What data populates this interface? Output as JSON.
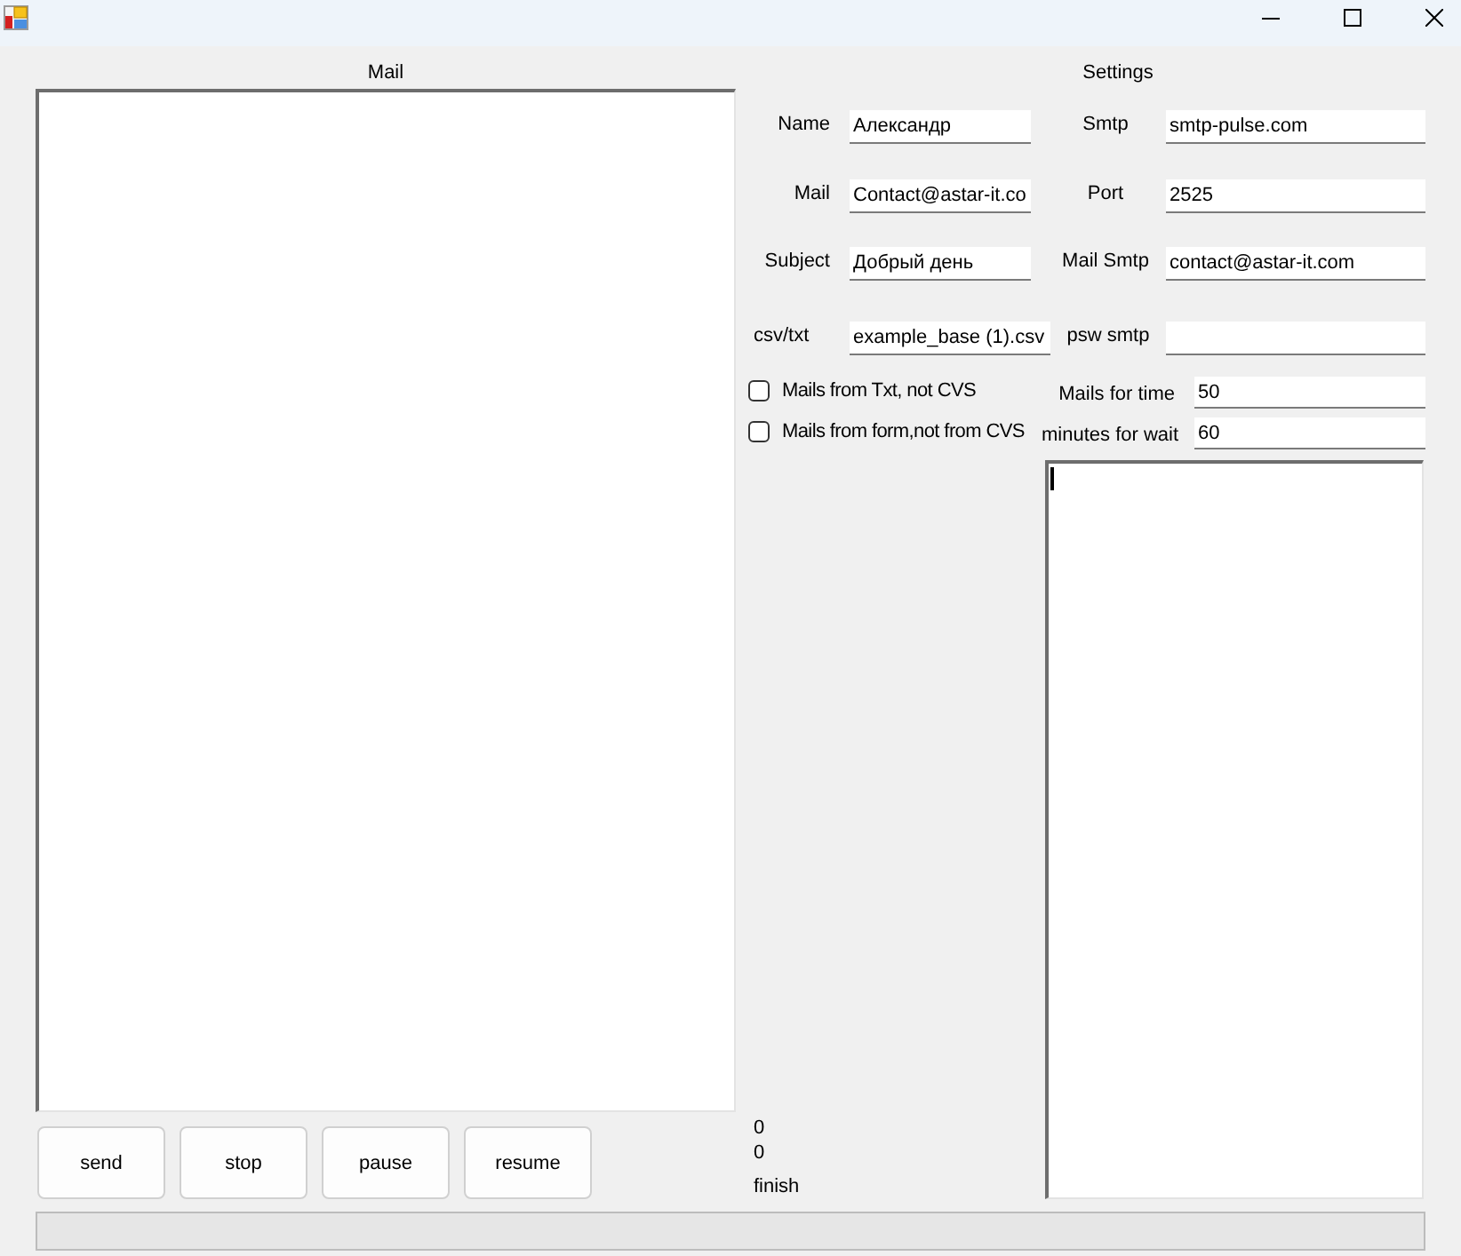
{
  "mail": {
    "heading": "Mail"
  },
  "buttons": [
    {
      "label": "send"
    },
    {
      "label": "stop"
    },
    {
      "label": "pause"
    },
    {
      "label": "resume"
    }
  ],
  "settings": {
    "heading": "Settings",
    "field_rows": [
      [
        {
          "label": "Name",
          "value": "Александр"
        },
        {
          "label": "Smtp",
          "value": "smtp-pulse.com"
        }
      ],
      [
        {
          "label": "Mail",
          "value": "Contact@astar-it.co"
        },
        {
          "label": "Port",
          "value": "2525"
        }
      ],
      [
        {
          "label": "Subject",
          "value": "Добрый день"
        },
        {
          "label": "Mail Smtp",
          "value": "contact@astar-it.com"
        }
      ],
      [
        {
          "label": "csv/txt",
          "value": "example_base (1).csv"
        },
        {
          "label": "psw smtp"
        }
      ]
    ],
    "option_rows": [
      {
        "checkbox": {
          "label": "Mails from Txt, not CVS",
          "checked": false
        },
        "limit": {
          "label": "Mails for time",
          "value": "50"
        }
      },
      {
        "checkbox": {
          "label": "Mails from form,not from CVS",
          "checked": false
        },
        "limit": {
          "label": "minutes for wait",
          "value": "60"
        }
      }
    ],
    "log": {
      "focused": true
    }
  },
  "counters": [
    "0",
    "0"
  ],
  "status_text": "finish",
  "progress": {
    "level": 0
  }
}
